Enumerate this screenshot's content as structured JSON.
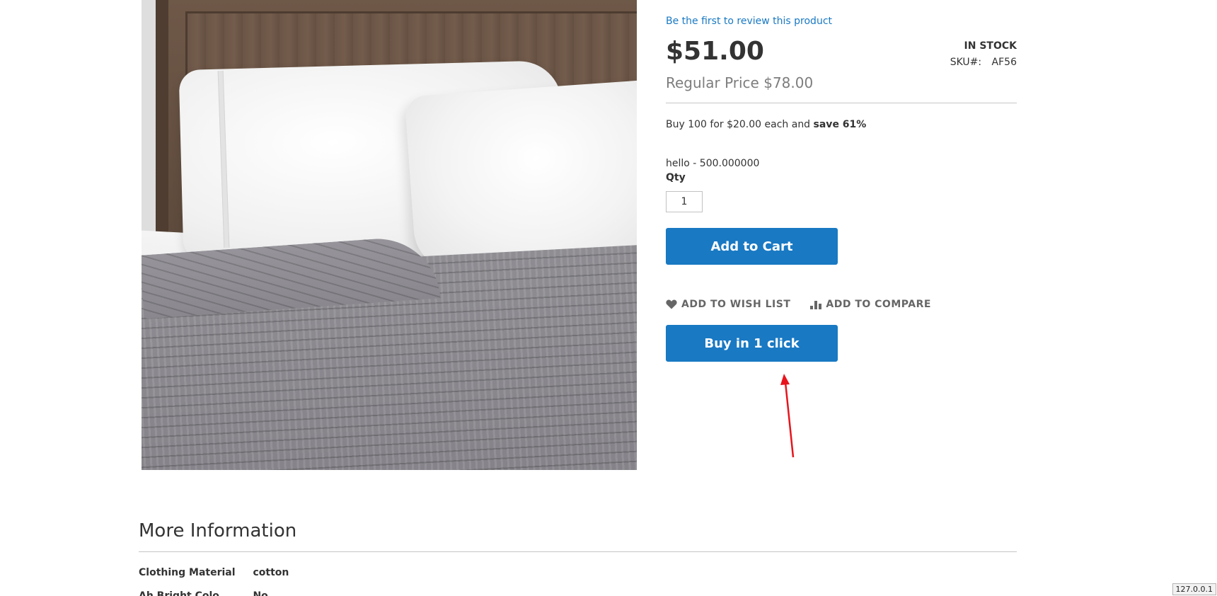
{
  "product": {
    "review_link": "Be the first to review this product",
    "price": "$51.00",
    "regular_price_label": "Regular Price",
    "regular_price": "$78.00",
    "stock_status": "IN STOCK",
    "sku_label": "SKU#:",
    "sku_value": "AF56",
    "tier_price_text": "Buy 100 for $20.00 each and",
    "tier_price_save": "save 61%",
    "option_line": "hello - 500.000000",
    "qty_label": "Qty",
    "qty_value": "1",
    "add_to_cart_label": "Add to Cart",
    "wishlist_label": "Add to Wish List",
    "compare_label": "Add to Compare",
    "buy_one_click_label": "Buy in 1 click"
  },
  "more_info": {
    "title": "More Information",
    "attributes": [
      {
        "label": "Clothing Material",
        "value": "cotton"
      },
      {
        "label": "Ah Bright Colo",
        "value": "No"
      }
    ]
  },
  "status_bar": {
    "url": "127.0.0.1"
  },
  "colors": {
    "accent": "#1979c3",
    "annotation": "#e8141c"
  },
  "icons": {
    "wishlist": "heart-icon",
    "compare": "bar-chart-icon"
  }
}
